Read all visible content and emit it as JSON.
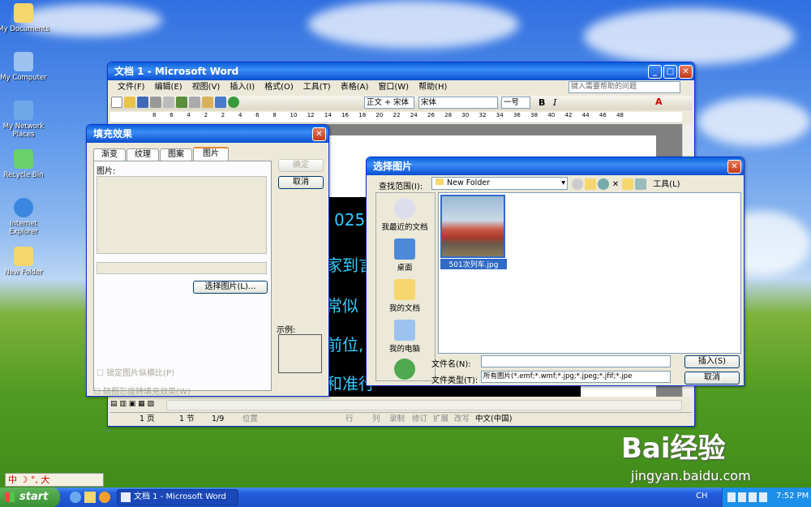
{
  "desktop": {
    "icons": [
      {
        "label": "My Documents"
      },
      {
        "label": "My Computer"
      },
      {
        "label": "My Network Places"
      },
      {
        "label": "Recycle Bin"
      },
      {
        "label": "Internet Explorer"
      },
      {
        "label": "New Folder"
      }
    ]
  },
  "word": {
    "title": "文档 1 - Microsoft Word",
    "menus": [
      "文件(F)",
      "编辑(E)",
      "视图(V)",
      "插入(I)",
      "格式(O)",
      "工具(T)",
      "表格(A)",
      "窗口(W)",
      "帮助(H)"
    ],
    "help_placeholder": "键入需要帮助的问题",
    "style": "正文 + 宋体",
    "font": "宋体",
    "size": "一号",
    "ruler": [
      "8",
      "6",
      "4",
      "2",
      "2",
      "4",
      "6",
      "8",
      "10",
      "12",
      "14",
      "16",
      "18",
      "20",
      "22",
      "24",
      "26",
      "28",
      "30",
      "32",
      "34",
      "36",
      "38",
      "40",
      "42",
      "44",
      "46",
      "48"
    ],
    "doc_text": [
      "025",
      "家到言",
      "常似",
      "前位,",
      "和准行"
    ],
    "status": {
      "page": "1 页",
      "section": "1 节",
      "pages": "1/9",
      "position": "位置",
      "line": "行",
      "col": "列",
      "rec": "录制",
      "trk": "修订",
      "ext": "扩展",
      "ovr": "改写",
      "lang": "中文(中国)"
    }
  },
  "fill_dialog": {
    "title": "填充效果",
    "tabs": [
      "渐变",
      "纹理",
      "图案",
      "图片"
    ],
    "active_tab": "图片",
    "picture_label": "图片:",
    "select_button": "选择图片(L)...",
    "ok": "确定",
    "cancel": "取消",
    "sample_label": "示例:",
    "lock_ratio": "锁定图片纵横比(P)",
    "rotate_fill": "随图形旋转填充效果(W)"
  },
  "select_dialog": {
    "title": "选择图片",
    "lookin_label": "查找范围(I):",
    "lookin_value": "New Folder",
    "tools": "工具(L)",
    "places": [
      "我最近的文档",
      "桌面",
      "我的文档",
      "我的电脑"
    ],
    "file": {
      "name": "501次列车.jpg"
    },
    "filename_label": "文件名(N):",
    "filetype_label": "文件类型(T):",
    "filetype_value": "所有图片(*.emf;*.wmf;*.jpg;*.jpeg;*.jfif;*.jpe",
    "insert": "插入(S)",
    "cancel": "取消"
  },
  "ime": {
    "text": "中 ☽ °, 大"
  },
  "taskbar": {
    "start": "start",
    "task": "文档 1 - Microsoft Word",
    "lang": "CH",
    "time": "7:52 PM"
  },
  "watermark": {
    "brand": "Bai经验",
    "url": "jingyan.baidu.com"
  }
}
